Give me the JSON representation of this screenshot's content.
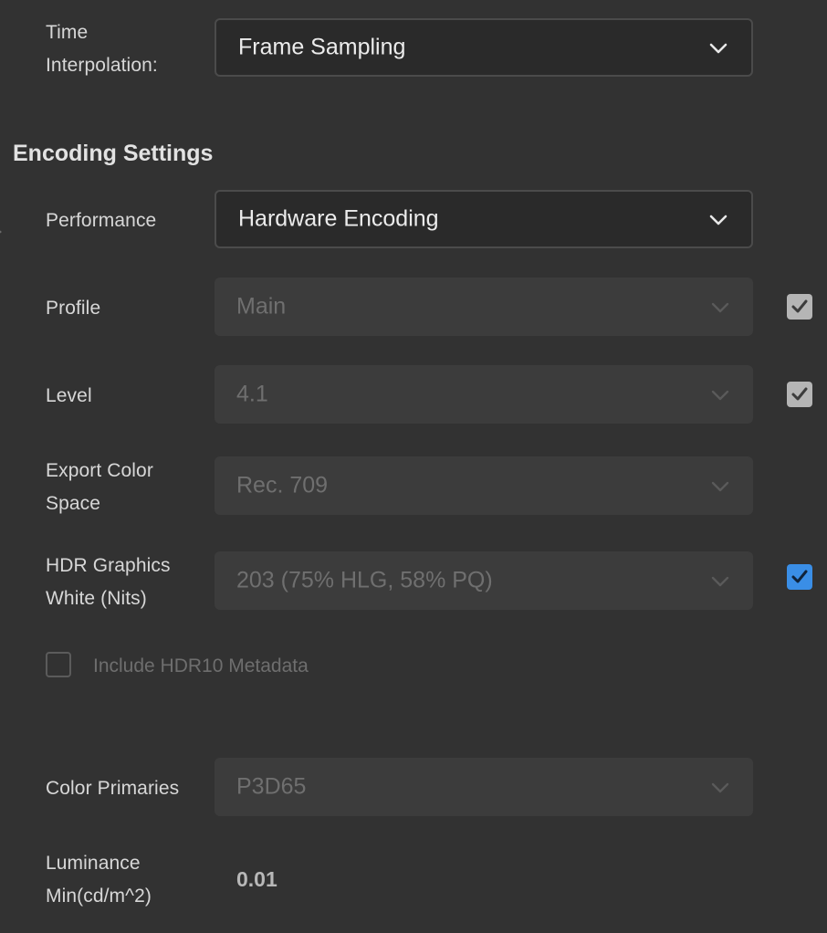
{
  "time_interpolation": {
    "label_line1": "Time",
    "label_line2": "Interpolation:",
    "value": "Frame Sampling"
  },
  "encoding_settings": {
    "title": "Encoding Settings",
    "performance": {
      "label": "Performance",
      "value": "Hardware Encoding"
    },
    "profile": {
      "label": "Profile",
      "value": "Main",
      "checked": true
    },
    "level": {
      "label": "Level",
      "value": "4.1",
      "checked": true
    },
    "export_color_space": {
      "label_line1": "Export Color",
      "label_line2": "Space",
      "value": "Rec. 709"
    },
    "hdr_graphics_white": {
      "label_line1": "HDR Graphics",
      "label_line2": "White (Nits)",
      "value": "203 (75% HLG, 58% PQ)",
      "checked": true
    },
    "include_hdr10": {
      "label": "Include HDR10 Metadata",
      "checked": false
    },
    "color_primaries": {
      "label": "Color Primaries",
      "value": "P3D65"
    },
    "luminance_min": {
      "label_line1": "Luminance",
      "label_line2": "Min(cd/m^2)",
      "value": "0.01"
    }
  },
  "icons": {
    "dropdown": "chevron-down-icon",
    "check": "checkmark-icon"
  },
  "colors": {
    "background": "#323232",
    "checkbox_accent": "#3a8ee6",
    "checkbox_gray": "#b5b5b5"
  }
}
